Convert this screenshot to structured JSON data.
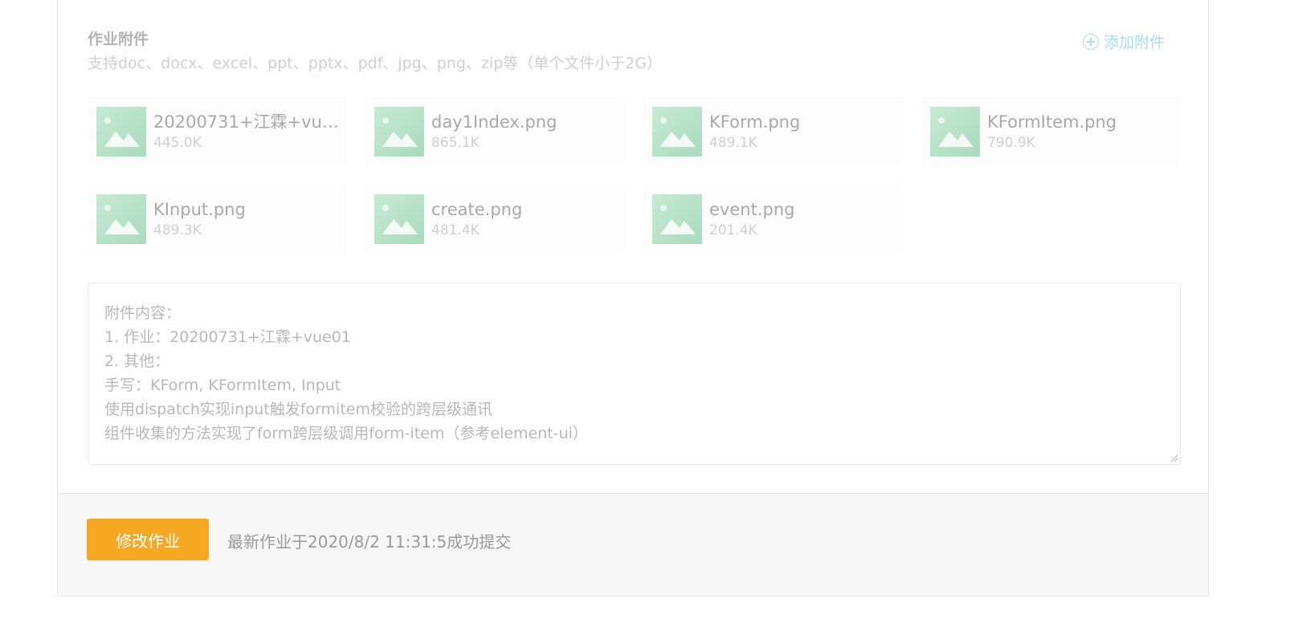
{
  "attachments_section": {
    "title": "作业附件",
    "hint": "支持doc、docx、excel、ppt、pptx、pdf、jpg、png、zip等（单个文件小于2G）",
    "add_label": "添加附件",
    "add_icon": "plus-circle-icon"
  },
  "files": [
    {
      "name": "20200731+江霖+vue0...",
      "size": "445.0K",
      "icon": "image-icon"
    },
    {
      "name": "day1Index.png",
      "size": "865.1K",
      "icon": "image-icon"
    },
    {
      "name": "KForm.png",
      "size": "489.1K",
      "icon": "image-icon"
    },
    {
      "name": "KFormItem.png",
      "size": "790.9K",
      "icon": "image-icon"
    },
    {
      "name": "KInput.png",
      "size": "489.3K",
      "icon": "image-icon"
    },
    {
      "name": "create.png",
      "size": "481.4K",
      "icon": "image-icon"
    },
    {
      "name": "event.png",
      "size": "201.4K",
      "icon": "image-icon"
    }
  ],
  "content": {
    "lines": [
      "附件内容：",
      "1. 作业：20200731+江霖+vue01",
      "2. 其他：",
      "手写：KForm, KFormItem, Input",
      "使用dispatch实现input触发formitem校验的跨层级通讯",
      "组件收集的方法实现了form跨层级调用form-item（参考element-ui）"
    ]
  },
  "footer": {
    "edit_button_label": "修改作业",
    "status_text": "最新作业于2020/8/2 11:31:5成功提交"
  },
  "colors": {
    "accent_button": "#f7a823",
    "add_link": "#a8dcef",
    "thumb": "#b9e3c9"
  }
}
